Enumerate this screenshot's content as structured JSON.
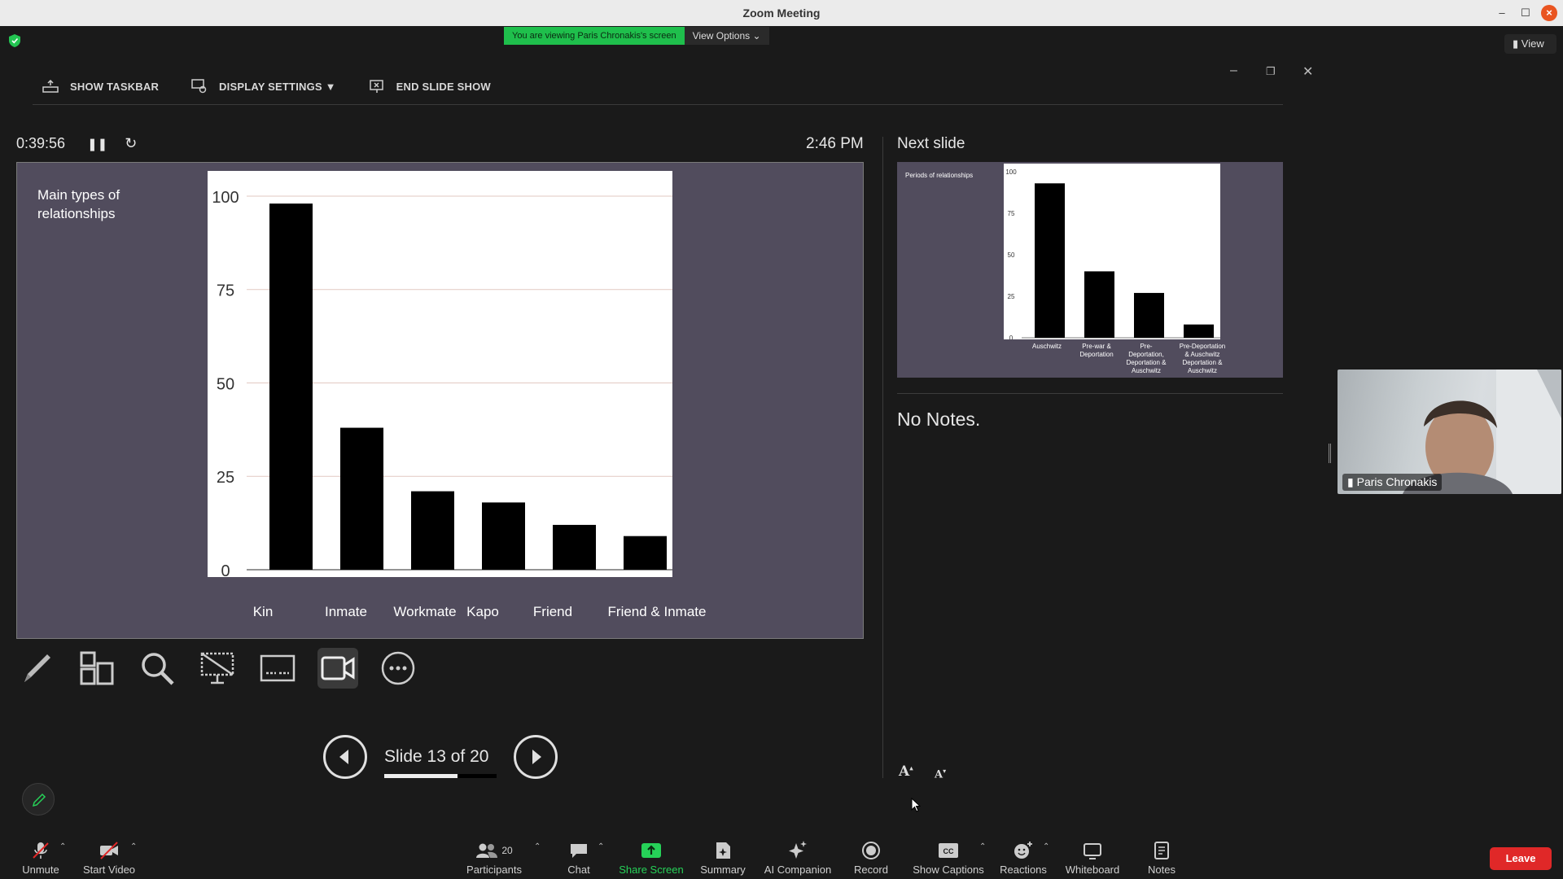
{
  "window": {
    "title": "Zoom Meeting"
  },
  "banner": {
    "viewing_text": "You are viewing Paris Chronakis's screen",
    "view_options": "View Options",
    "view_button": "View"
  },
  "presenter_bar": {
    "show_taskbar": "SHOW TASKBAR",
    "display_settings": "DISPLAY SETTINGS ▼",
    "end_slide_show": "END SLIDE SHOW"
  },
  "presenter": {
    "elapsed": "0:39:56",
    "clock": "2:46 PM",
    "slide_counter": "Slide 13 of 20",
    "progress_fraction": 0.65
  },
  "current_slide": {
    "title": "Main types of relationships"
  },
  "chart_data": [
    {
      "type": "bar",
      "title": "Main types of relationships",
      "categories": [
        "Kin",
        "Inmate",
        "Workmate",
        "Kapo",
        "Friend",
        "Friend & Inmate"
      ],
      "values": [
        98,
        38,
        21,
        18,
        12,
        9
      ],
      "yticks": [
        "0",
        "25",
        "50",
        "75",
        "100"
      ],
      "ylim": [
        0,
        105
      ],
      "grid": true,
      "legend": "none"
    },
    {
      "type": "bar",
      "title": "Periods of relationships",
      "categories": [
        "Auschwitz",
        "Pre-war & Deportation",
        "Pre-Deportation, Deportation & Auschwitz",
        "Pre-Deportation & Auschwitz Deportation & Auschwitz"
      ],
      "values": [
        93,
        40,
        27,
        8
      ],
      "yticks": [
        "0",
        "25",
        "50",
        "75",
        "100"
      ],
      "ylim": [
        0,
        100
      ],
      "grid": false,
      "legend": "none"
    }
  ],
  "next_slide": {
    "label": "Next slide"
  },
  "notes": {
    "text": "No Notes.",
    "font_increase": "A",
    "font_decrease": "A"
  },
  "participant": {
    "name": "Paris Chronakis"
  },
  "toolbar": {
    "unmute": "Unmute",
    "start_video": "Start Video",
    "participants": "Participants",
    "participants_count": "20",
    "chat": "Chat",
    "share_screen": "Share Screen",
    "summary": "Summary",
    "ai_companion": "AI Companion",
    "record": "Record",
    "show_captions": "Show Captions",
    "reactions": "Reactions",
    "whiteboard": "Whiteboard",
    "notes": "Notes",
    "leave": "Leave"
  },
  "colors": {
    "slide_bg": "#514c5d",
    "share_green": "#26d158",
    "leave_red": "#e02828",
    "banner_green": "#1fbf4c"
  }
}
